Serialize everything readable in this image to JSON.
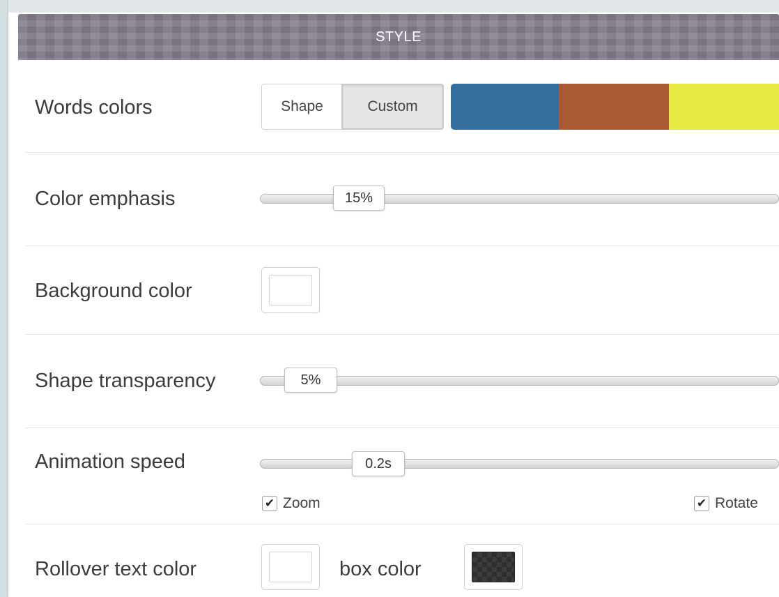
{
  "header": {
    "title": "STYLE"
  },
  "rows": {
    "words_colors": {
      "label": "Words colors",
      "options": [
        "Shape",
        "Custom"
      ],
      "selected": "Custom",
      "colors": [
        "#356d9e",
        "#a85b32",
        "#e5e943"
      ]
    },
    "color_emphasis": {
      "label": "Color emphasis",
      "value": "15%"
    },
    "background_color": {
      "label": "Background color",
      "color": "#ffffff"
    },
    "shape_transparency": {
      "label": "Shape transparency",
      "value": "5%"
    },
    "animation_speed": {
      "label": "Animation speed",
      "value": "0.2s",
      "checkboxes": [
        {
          "label": "Zoom",
          "checked": true
        },
        {
          "label": "Rotate",
          "checked": true
        }
      ]
    },
    "rollover": {
      "label": "Rollover text color",
      "text_color": "#ffffff",
      "box_label": "box color",
      "box_color": "#2e2e2e"
    }
  },
  "icons": {
    "checkmark": "checkmark-icon"
  }
}
